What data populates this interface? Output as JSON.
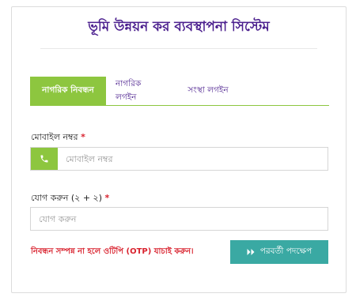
{
  "header": {
    "title": "ভূমি উন্নয়ন কর ব্যবস্থাপনা সিস্টেম"
  },
  "tabs": [
    {
      "label": "নাগরিক নিবন্ধন",
      "active": true
    },
    {
      "label": "নাগরিক লগইন",
      "active": false
    },
    {
      "label": "সংস্থা লগইন",
      "active": false
    }
  ],
  "form": {
    "mobile_label": "মোবাইল নম্বর",
    "required_mark": "*",
    "mobile_placeholder": "মোবাইল নম্বর",
    "mobile_value": "",
    "sum_label": "যোগ করুন (২ + ২)",
    "sum_placeholder": "যোগ করুন",
    "sum_value": "",
    "warning": "নিবন্ধন সম্পন্ন না হলে ওটিপি (OTP) যাচাই করুন।",
    "next_button_label": "পরবর্তী পদক্ষেপ"
  },
  "icons": {
    "addon": "phone-icon",
    "next": "double-arrow-right-icon"
  },
  "colors": {
    "brand_purple": "#4b1f8e",
    "accent_green": "#8dc63f",
    "button_teal": "#3aa9a3",
    "error_red": "#d9232f"
  }
}
